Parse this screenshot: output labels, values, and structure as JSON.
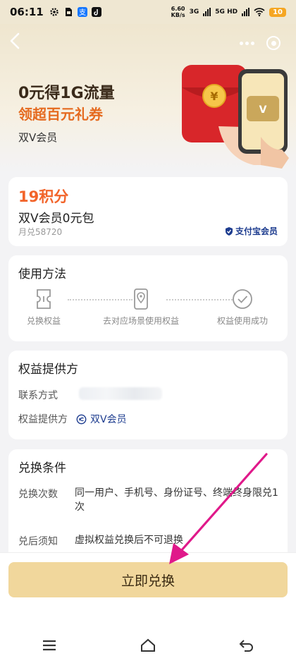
{
  "status_bar": {
    "time": "06:11",
    "net_speed": "6.60",
    "net_unit": "KB/s",
    "sig1": "3G",
    "sig2": "5G HD",
    "battery": "10"
  },
  "hero": {
    "title": "0元得1G流量",
    "subtitle": "领超百元礼券",
    "brand": "双V会员",
    "accent": "#e56a1f"
  },
  "product_card": {
    "points": "19积分",
    "name": "双V会员0元包",
    "monthly": "月兑58720",
    "badge": "支付宝会员"
  },
  "usage": {
    "title": "使用方法",
    "steps": [
      {
        "label": "兑换权益",
        "icon": "ticket-icon"
      },
      {
        "label": "去对应场景使用权益",
        "icon": "location-pin-icon"
      },
      {
        "label": "权益使用成功",
        "icon": "check-circle-icon"
      }
    ]
  },
  "provider": {
    "title": "权益提供方",
    "contact_label": "联系方式",
    "provider_label": "权益提供方",
    "provider_value": "双V会员"
  },
  "conditions": {
    "title": "兑换条件",
    "rows": [
      {
        "label": "兑换次数",
        "value": "同一用户、手机号、身份证号、终端终身限兑1次"
      },
      {
        "label": "兑后须知",
        "value": "虚拟权益兑换后不可退换"
      }
    ]
  },
  "action": {
    "redeem_label": "立即兑换",
    "color": "#f1d79c"
  },
  "annotation": {
    "arrow_color": "#e0198a"
  }
}
